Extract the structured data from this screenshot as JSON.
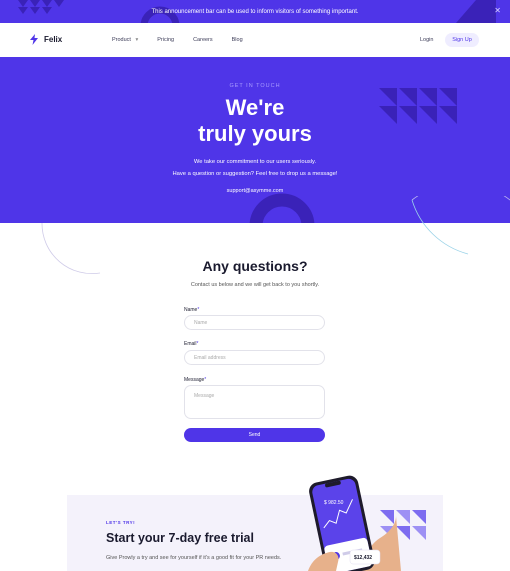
{
  "announcement": {
    "text": "This announcement bar can be used to inform visitors of something important.",
    "close_label": "✕"
  },
  "nav": {
    "brand": "Felix",
    "links": [
      "Product",
      "Pricing",
      "Careers",
      "Blog"
    ],
    "product_caret": "▾",
    "login_label": "Login",
    "signup_label": "Sign Up"
  },
  "hero": {
    "eyebrow": "GET IN TOUCH",
    "title_line1": "We're",
    "title_line2": "truly yours",
    "subtitle_line1": "We take our commitment to our users seriously.",
    "subtitle_line2": "Have a question or suggestion? Feel free to drop us a message!",
    "email": "support@asymme.com"
  },
  "contact": {
    "title": "Any questions?",
    "subtitle": "Contact us below and we will get back to you shortly.",
    "name_label": "Name",
    "name_placeholder": "Name",
    "email_label": "Email",
    "email_placeholder": "Email address",
    "message_label": "Message",
    "message_placeholder": "Message",
    "required_mark": "*",
    "send_label": "Send"
  },
  "trial": {
    "eyebrow": "LET'S TRY!",
    "title": "Start your 7-day free trial",
    "subtitle": "Give Prowly a try and see for yourself if it's a good fit for your PR needs.",
    "phone_balance": "$ 982.50",
    "phone_amount": "$12,432"
  },
  "colors": {
    "brand": "#4f35e8",
    "dark_triangles": "#3a22b8",
    "light_bg": "#f4f2fb"
  }
}
